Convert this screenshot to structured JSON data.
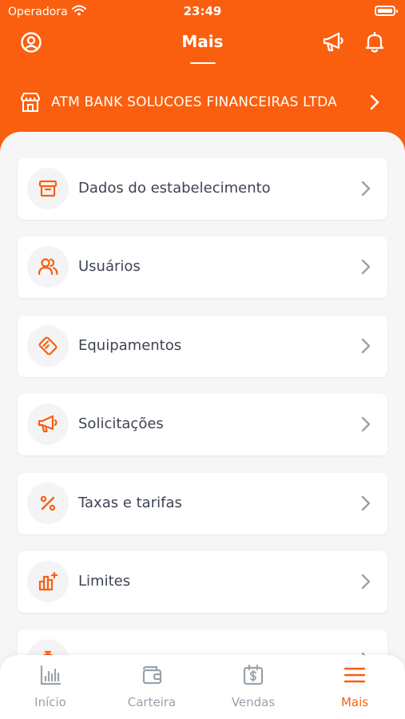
{
  "status_bar": {
    "carrier": "Operadora",
    "time": "23:49"
  },
  "header": {
    "title": "Mais"
  },
  "merchant": {
    "name": "ATM BANK SOLUCOES FINANCEIRAS LTDA"
  },
  "menu": {
    "items": [
      {
        "label": "Dados do estabelecimento",
        "icon": "archive-box-icon"
      },
      {
        "label": "Usuários",
        "icon": "users-icon"
      },
      {
        "label": "Equipamentos",
        "icon": "card-machine-icon"
      },
      {
        "label": "Solicitações",
        "icon": "megaphone-icon"
      },
      {
        "label": "Taxas e tarifas",
        "icon": "percent-icon"
      },
      {
        "label": "Limites",
        "icon": "chart-plus-icon"
      },
      {
        "label": "",
        "icon": "stopwatch-icon"
      }
    ]
  },
  "tabbar": {
    "tabs": [
      {
        "label": "Início",
        "icon": "bar-chart-icon",
        "active": false
      },
      {
        "label": "Carteira",
        "icon": "wallet-icon",
        "active": false
      },
      {
        "label": "Vendas",
        "icon": "calendar-dollar-icon",
        "active": false
      },
      {
        "label": "Mais",
        "icon": "menu-icon",
        "active": true
      }
    ]
  },
  "colors": {
    "accent": "#fa5f0f",
    "text": "#3d4451",
    "muted": "#98a2ac",
    "background": "#f6f6f6"
  }
}
